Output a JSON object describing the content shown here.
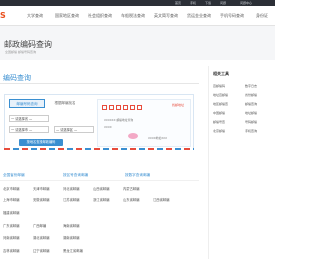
{
  "topbar": {
    "items": [
      "首页",
      "手机",
      "下载",
      "问题",
      "问题中心"
    ]
  },
  "nav": {
    "logo": "S",
    "items": [
      "大学查询",
      "国家地区查询",
      "社会组织查询",
      "车船税法查询",
      "英文简写查询",
      "货运金业查询",
      "手机号码查询",
      "身份证"
    ]
  },
  "subhead": {
    "title": "邮政编码查询",
    "subtitle": "全国邮编 邮编号码查询"
  },
  "main": {
    "title": "编码查询"
  },
  "card": {
    "tab_active": "邮编号码查询",
    "tab_second": "根据邮编找名",
    "selects": [
      "一 请选择省 —",
      "一 请选择市 —",
      "— 请选择区 —"
    ],
    "query_btn": "按地名查找邮政编码",
    "top_link": "找邮地址",
    "note1": "XXXXXX 邮编地址查询",
    "note2": "XXXX",
    "note3": "XXXX地址XXX"
  },
  "sidebar": {
    "title": "相关工具",
    "items": [
      "百邮编码",
      "数字日志",
      "地址百邮编",
      "省份邮编",
      "地区邮编查",
      "邮编查询",
      "中国邮编",
      "地址邮编",
      "邮编号查",
      "号码邮编",
      "北京邮编",
      "手机查询"
    ]
  },
  "lists": {
    "col1_title": "全国省份邮编",
    "col2_title": "按区号查询邮编",
    "col3_title": "按数字查询邮编",
    "rows": [
      [
        "北京市邮编",
        "天津市邮编",
        "河北省邮编",
        "山西省邮编",
        "内蒙古邮编"
      ],
      [
        "上海市邮编",
        "安徽省邮编",
        "江苏省邮编",
        "浙江省邮编",
        "山东省邮编",
        "江西省邮编"
      ],
      [
        "福建省邮编"
      ],
      [
        "广东省邮编",
        "广西邮编",
        "海南省邮编"
      ],
      [
        "河南省邮编",
        "湖北省邮编",
        "湖南省邮编"
      ],
      [
        "吉林省邮编",
        "辽宁省邮编",
        "黑龙江省邮编"
      ]
    ]
  },
  "colors": {
    "accent": "#3a8fd1",
    "brand": "#e94e1b",
    "topbar": "#2b2f36"
  }
}
